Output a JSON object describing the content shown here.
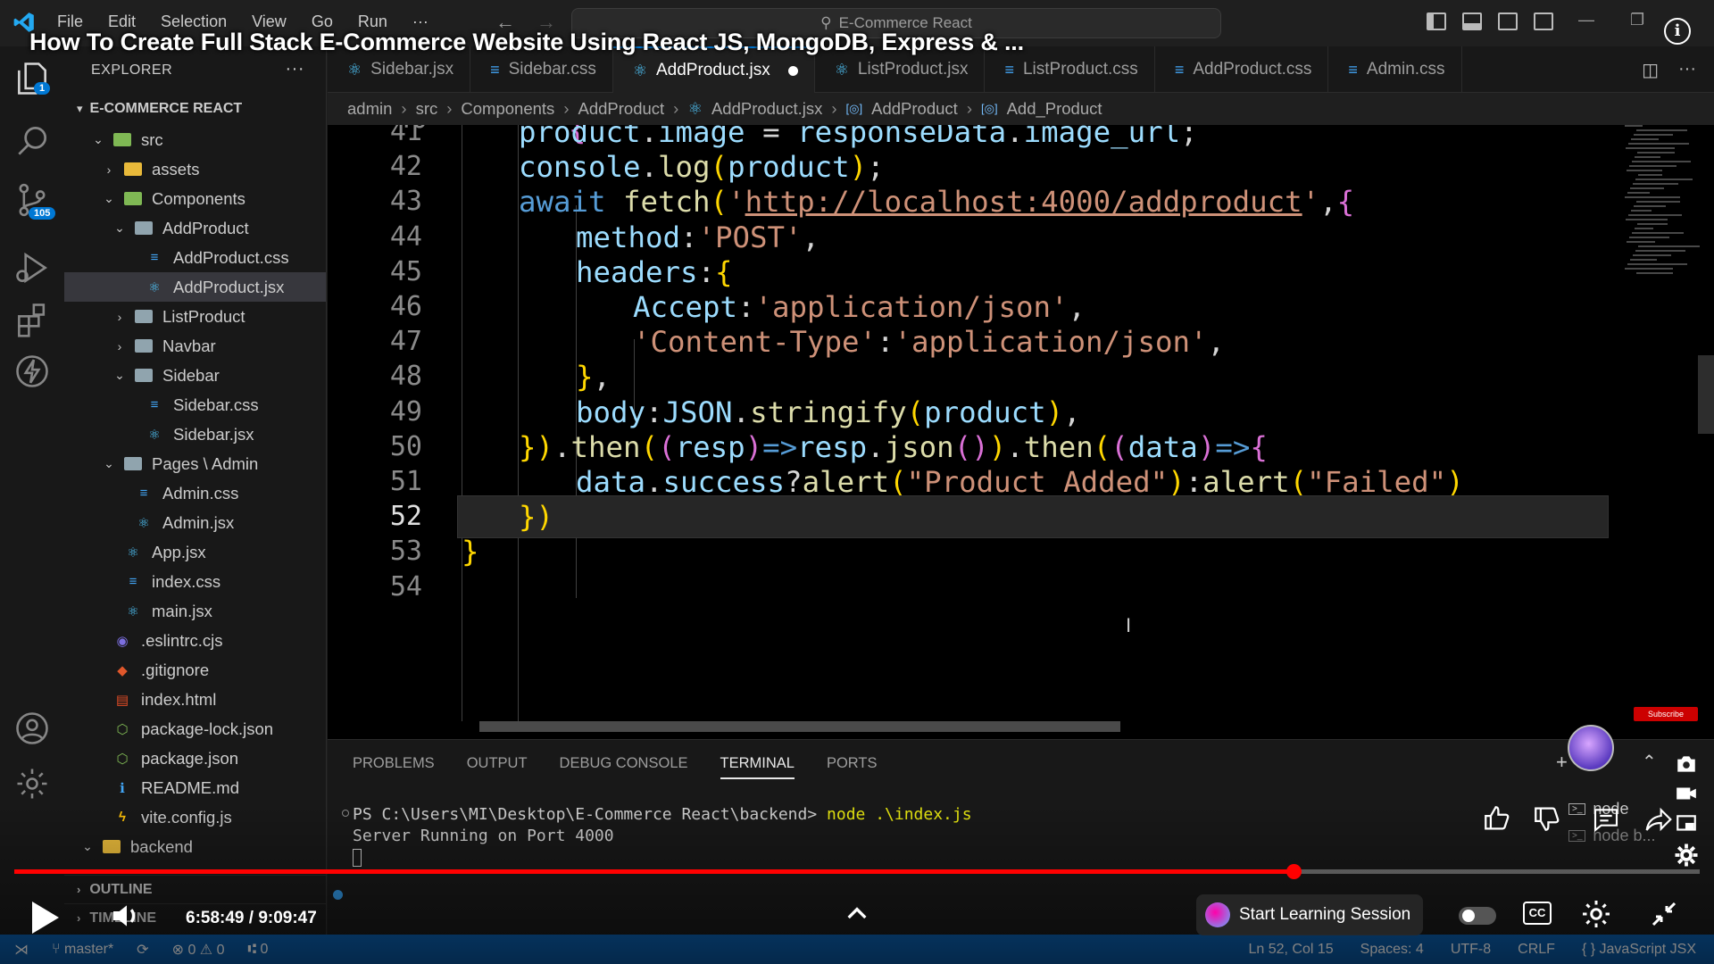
{
  "video": {
    "title": "How To Create Full Stack E-Commerce Website Using React JS, MongoDB, Express & ...",
    "time": "6:58:49 / 9:09:47",
    "progress": 0.7588,
    "learn_button": "Start Learning Session",
    "cc_label": "CC",
    "subscribe": "Subscribe"
  },
  "titlebar": {
    "menu": [
      "File",
      "Edit",
      "Selection",
      "View",
      "Go",
      "Run",
      "···"
    ],
    "command_center": "E-Commerce React"
  },
  "activity": {
    "explorer_badge": "1",
    "scm_badge": "105"
  },
  "sidebar": {
    "header": "EXPLORER",
    "header_dots": "···",
    "section": "E-COMMERCE REACT",
    "tree": [
      {
        "label": "src",
        "depth": 1,
        "type": "folder-open",
        "color": "#7fb854"
      },
      {
        "label": "assets",
        "depth": 2,
        "type": "folder",
        "color": "#e8b93a"
      },
      {
        "label": "Components",
        "depth": 2,
        "type": "folder-open",
        "color": "#7fb854"
      },
      {
        "label": "AddProduct",
        "depth": 3,
        "type": "folder-open",
        "color": "#90a4ae"
      },
      {
        "label": "AddProduct.css",
        "depth": 4,
        "type": "css",
        "color": "#42a5f5"
      },
      {
        "label": "AddProduct.jsx",
        "depth": 4,
        "type": "react",
        "color": "#4fc3f7",
        "selected": true
      },
      {
        "label": "ListProduct",
        "depth": 3,
        "type": "folder",
        "color": "#90a4ae"
      },
      {
        "label": "Navbar",
        "depth": 3,
        "type": "folder",
        "color": "#90a4ae"
      },
      {
        "label": "Sidebar",
        "depth": 3,
        "type": "folder-open",
        "color": "#90a4ae"
      },
      {
        "label": "Sidebar.css",
        "depth": 4,
        "type": "css",
        "color": "#42a5f5"
      },
      {
        "label": "Sidebar.jsx",
        "depth": 4,
        "type": "react",
        "color": "#4fc3f7"
      },
      {
        "label": "Pages \\ Admin",
        "depth": 2,
        "type": "folder-open",
        "color": "#90a4ae"
      },
      {
        "label": "Admin.css",
        "depth": 3,
        "type": "css",
        "color": "#42a5f5"
      },
      {
        "label": "Admin.jsx",
        "depth": 3,
        "type": "react",
        "color": "#4fc3f7"
      },
      {
        "label": "App.jsx",
        "depth": 2,
        "type": "react",
        "color": "#4fc3f7"
      },
      {
        "label": "index.css",
        "depth": 2,
        "type": "css",
        "color": "#42a5f5"
      },
      {
        "label": "main.jsx",
        "depth": 2,
        "type": "react",
        "color": "#4fc3f7"
      },
      {
        "label": ".eslintrc.cjs",
        "depth": 1,
        "type": "eslint",
        "color": "#7c6fe0"
      },
      {
        "label": ".gitignore",
        "depth": 1,
        "type": "git",
        "color": "#e0572b"
      },
      {
        "label": "index.html",
        "depth": 1,
        "type": "html",
        "color": "#e44d26"
      },
      {
        "label": "package-lock.json",
        "depth": 1,
        "type": "npm",
        "color": "#7fb854"
      },
      {
        "label": "package.json",
        "depth": 1,
        "type": "npm",
        "color": "#7fb854"
      },
      {
        "label": "README.md",
        "depth": 1,
        "type": "info",
        "color": "#42a5f5"
      },
      {
        "label": "vite.config.js",
        "depth": 1,
        "type": "vite",
        "color": "#ffc107"
      },
      {
        "label": "backend",
        "depth": 0,
        "type": "folder-open",
        "color": "#e8b93a"
      }
    ],
    "outline": "OUTLINE",
    "timeline": "TIMELINE"
  },
  "tabs": [
    {
      "label": "Sidebar.jsx",
      "icon": "react"
    },
    {
      "label": "Sidebar.css",
      "icon": "css"
    },
    {
      "label": "AddProduct.jsx",
      "icon": "react",
      "active": true,
      "dirty": true
    },
    {
      "label": "ListProduct.jsx",
      "icon": "react"
    },
    {
      "label": "ListProduct.css",
      "icon": "css"
    },
    {
      "label": "AddProduct.css",
      "icon": "css"
    },
    {
      "label": "Admin.css",
      "icon": "css"
    }
  ],
  "breadcrumb": [
    "admin",
    "src",
    "Components",
    "AddProduct",
    "AddProduct.jsx",
    "AddProduct",
    "Add_Product"
  ],
  "editor": {
    "lines": [
      {
        "n": "41",
        "text": "product.image = responseData.image_url;"
      },
      {
        "n": "42",
        "text": "console.log(product);"
      },
      {
        "n": "43",
        "text": "await fetch('http://localhost:4000/addproduct',{"
      },
      {
        "n": "44",
        "text": "method:'POST',"
      },
      {
        "n": "45",
        "text": "headers:{"
      },
      {
        "n": "46",
        "text": "Accept:'application/json',"
      },
      {
        "n": "47",
        "text": "'Content-Type':'application/json',"
      },
      {
        "n": "48",
        "text": "},"
      },
      {
        "n": "49",
        "text": "body:JSON.stringify(product),"
      },
      {
        "n": "50",
        "text": "}).then((resp)=>resp.json()).then((data)=>{"
      },
      {
        "n": "51",
        "text": "data.success?alert(\"Product Added\"):alert(\"Failed\")"
      },
      {
        "n": "52",
        "text": "})"
      },
      {
        "n": "53",
        "text": "}"
      },
      {
        "n": "54",
        "text": ""
      }
    ],
    "current_line": "52"
  },
  "panel": {
    "tabs": [
      "PROBLEMS",
      "OUTPUT",
      "DEBUG CONSOLE",
      "TERMINAL",
      "PORTS"
    ],
    "active_tab": "TERMINAL",
    "prompt": "PS C:\\Users\\MI\\Desktop\\E-Commerce React\\backend>",
    "command": "node .\\index.js",
    "output": "Server Running on Port 4000",
    "terminals": [
      "node",
      "node b..."
    ]
  },
  "statusbar": {
    "branch": "master*",
    "errors": "0",
    "warnings": "0",
    "ports": "0",
    "position": "Ln 52, Col 15",
    "spaces": "Spaces: 4",
    "encoding": "UTF-8",
    "eol": "CRLF",
    "language": "JavaScript JSX"
  },
  "colors": {
    "accent": "#0078d4",
    "status": "#0a5aa6",
    "yt_red": "#ff0000"
  }
}
